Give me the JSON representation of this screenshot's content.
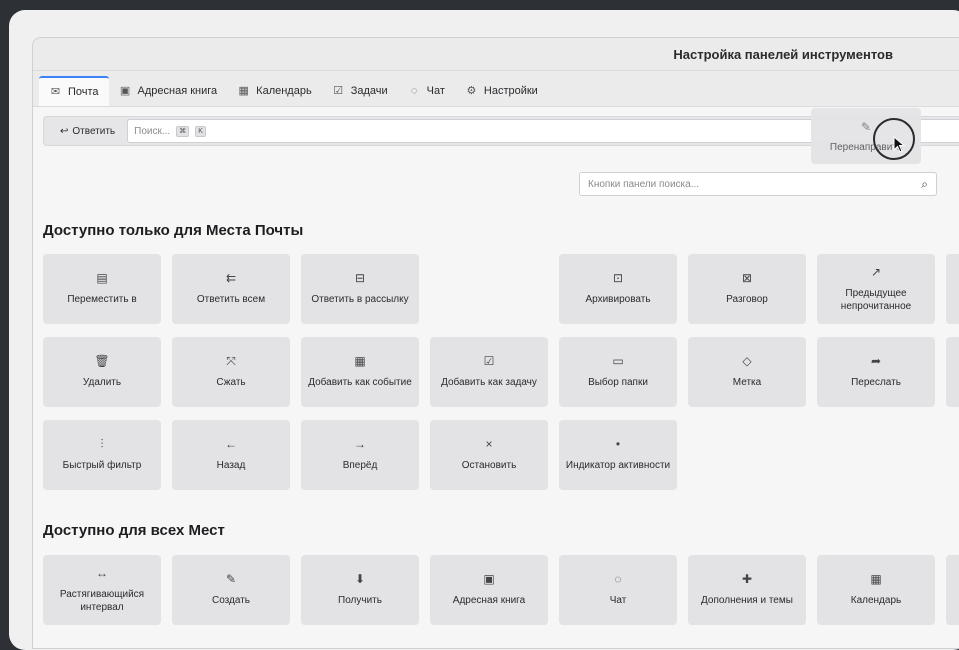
{
  "window": {
    "title": "Настройка панелей инструментов"
  },
  "tabs": [
    {
      "label": "Почта",
      "icon": "mail-icon",
      "glyph": "✉",
      "active": true
    },
    {
      "label": "Адресная книга",
      "icon": "address-book-icon",
      "glyph": "▣"
    },
    {
      "label": "Календарь",
      "icon": "calendar-icon",
      "glyph": "▦"
    },
    {
      "label": "Задачи",
      "icon": "tasks-icon",
      "glyph": "☑"
    },
    {
      "label": "Чат",
      "icon": "chat-icon",
      "glyph": "◌"
    },
    {
      "label": "Настройки",
      "icon": "settings-icon",
      "glyph": "⚙"
    }
  ],
  "toolbar": {
    "reply_label": "Ответить",
    "search_placeholder": "Поиск...",
    "kbd1": "⌘",
    "kbd2": "K"
  },
  "drag_item": {
    "label": "Перенаправить",
    "icon": "redirect-icon"
  },
  "search_buttons": {
    "placeholder": "Кнопки панели поиска..."
  },
  "section_mail": {
    "title": "Доступно только для Места Почты",
    "items": [
      {
        "label": "Переместить в",
        "icon": "move-to-icon",
        "glyph": "▤"
      },
      {
        "label": "Ответить всем",
        "icon": "reply-all-icon",
        "glyph": "⇇"
      },
      {
        "label": "Ответить в рассылку",
        "icon": "reply-list-icon",
        "glyph": "⊟"
      },
      {
        "label": "Архивировать",
        "icon": "archive-icon",
        "glyph": "⊡"
      },
      {
        "label": "Разговор",
        "icon": "conversation-icon",
        "glyph": "⊠"
      },
      {
        "label": "Предыдущее непрочитанное",
        "icon": "previous-unread-icon",
        "glyph": "↗"
      },
      {
        "label": "Удалить",
        "icon": "trash-icon",
        "glyph": "🗑"
      },
      {
        "label": "Сжать",
        "icon": "compact-icon",
        "glyph": "⤧"
      },
      {
        "label": "Добавить как событие",
        "icon": "add-event-icon",
        "glyph": "▦"
      },
      {
        "label": "Добавить как задачу",
        "icon": "add-task-icon",
        "glyph": "☑"
      },
      {
        "label": "Выбор папки",
        "icon": "folder-icon",
        "glyph": "▭"
      },
      {
        "label": "Метка",
        "icon": "tag-icon",
        "glyph": "◇"
      },
      {
        "label": "Переслать",
        "icon": "forward-icon",
        "glyph": "➦"
      },
      {
        "label": "Быстрый фильтр",
        "icon": "quick-filter-icon",
        "glyph": "⫶"
      },
      {
        "label": "Назад",
        "icon": "back-arrow-icon",
        "glyph": "←"
      },
      {
        "label": "Вперёд",
        "icon": "forward-arrow-icon",
        "glyph": "→"
      },
      {
        "label": "Остановить",
        "icon": "stop-icon",
        "glyph": "×"
      },
      {
        "label": "Индикатор активности",
        "icon": "activity-indicator-icon",
        "glyph": "•"
      }
    ]
  },
  "section_all": {
    "title": "Доступно для всех Мест",
    "items": [
      {
        "label": "Растягивающийся интервал",
        "icon": "spacer-icon",
        "glyph": "↔"
      },
      {
        "label": "Создать",
        "icon": "compose-icon",
        "glyph": "✎"
      },
      {
        "label": "Получить",
        "icon": "get-messages-icon",
        "glyph": "⬇"
      },
      {
        "label": "Адресная книга",
        "icon": "address-book-icon",
        "glyph": "▣"
      },
      {
        "label": "Чат",
        "icon": "chat-icon",
        "glyph": "◌"
      },
      {
        "label": "Дополнения и темы",
        "icon": "addons-icon",
        "glyph": "✚"
      },
      {
        "label": "Календарь",
        "icon": "calendar-icon",
        "glyph": "▦"
      }
    ]
  }
}
